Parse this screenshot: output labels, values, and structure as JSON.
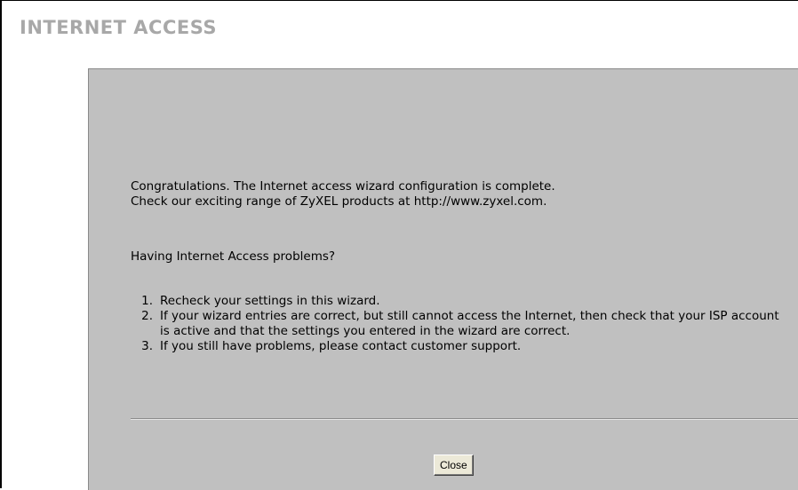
{
  "header": {
    "title": "INTERNET ACCESS"
  },
  "content": {
    "congrats_line1": "Congratulations. The Internet access wizard configuration is complete.",
    "congrats_line2": "Check our exciting range of ZyXEL products at http://www.zyxel.com.",
    "problems_heading": "Having Internet Access problems?",
    "steps": [
      {
        "number": "1.",
        "text": "Recheck your settings in this wizard."
      },
      {
        "number": "2.",
        "text": "If your wizard entries are correct, but still cannot access the Internet, then check that your ISP account is active and that the settings you entered in the wizard are correct."
      },
      {
        "number": "3.",
        "text": "If you still have problems, please contact customer support."
      }
    ]
  },
  "footer": {
    "close_label": "Close"
  },
  "colors": {
    "panel_bg": "#c0c0c0",
    "title_color": "#a8a8a8",
    "button_face": "#ece9d8"
  }
}
